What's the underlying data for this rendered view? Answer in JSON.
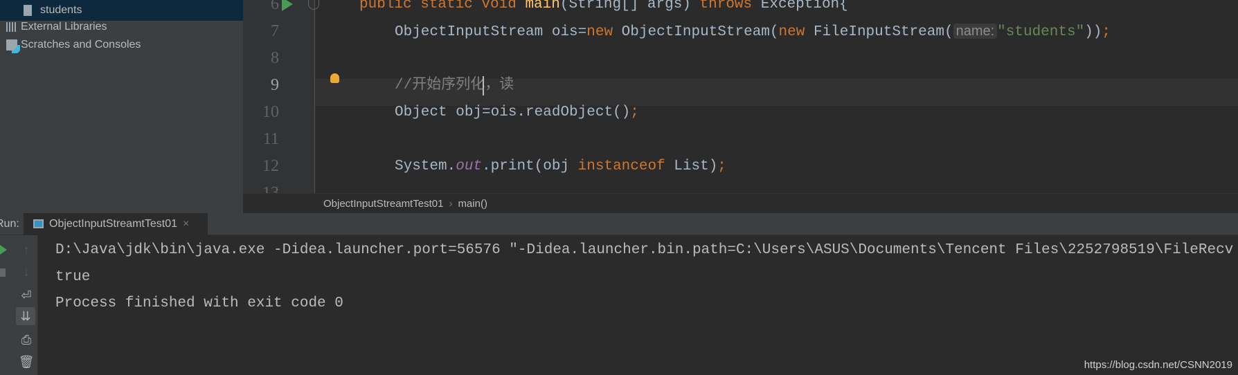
{
  "sidebar": {
    "items": [
      {
        "label": "students",
        "icon": "file-icon",
        "selected": true
      },
      {
        "label": "External Libraries",
        "icon": "libraries-icon"
      },
      {
        "label": "Scratches and Consoles",
        "icon": "scratches-icon"
      }
    ]
  },
  "editor": {
    "line_numbers": [
      "6",
      "7",
      "8",
      "9",
      "10",
      "11",
      "12",
      "13"
    ],
    "current_line": "9",
    "lines": {
      "l6": [
        "public static void ",
        "main",
        "(String[] args) ",
        "throws ",
        "Exception{"
      ],
      "l7": [
        "ObjectInputStream ois=",
        "new ",
        "ObjectInputStream(",
        "new ",
        "FileInputStream(",
        "name:",
        "\"students\"",
        "))",
        ";"
      ],
      "l9": "//开始序列化，读",
      "l10": [
        "Object obj=ois.readObject()",
        ";"
      ],
      "l12": [
        "System.",
        "out",
        ".print(obj ",
        "instanceof ",
        "List)",
        ";"
      ]
    },
    "breadcrumbs": [
      "ObjectInputStreamtTest01",
      "main()"
    ]
  },
  "run": {
    "label": "Run:",
    "tab": "ObjectInputStreamtTest01",
    "output": [
      "D:\\Java\\jdk\\bin\\java.exe -Didea.launcher.port=56576 \"-Didea.launcher.bin.path=C:\\Users\\ASUS\\Documents\\Tencent Files\\2252798519\\FileRecv",
      "true",
      "Process finished with exit code 0"
    ]
  },
  "watermark": "https://blog.csdn.net/CSNN2019",
  "colors": {
    "keyword": "#cc7832",
    "function": "#ffc66d",
    "string": "#6a8759",
    "comment": "#808080",
    "static": "#9876aa",
    "text": "#a9b7c6"
  }
}
